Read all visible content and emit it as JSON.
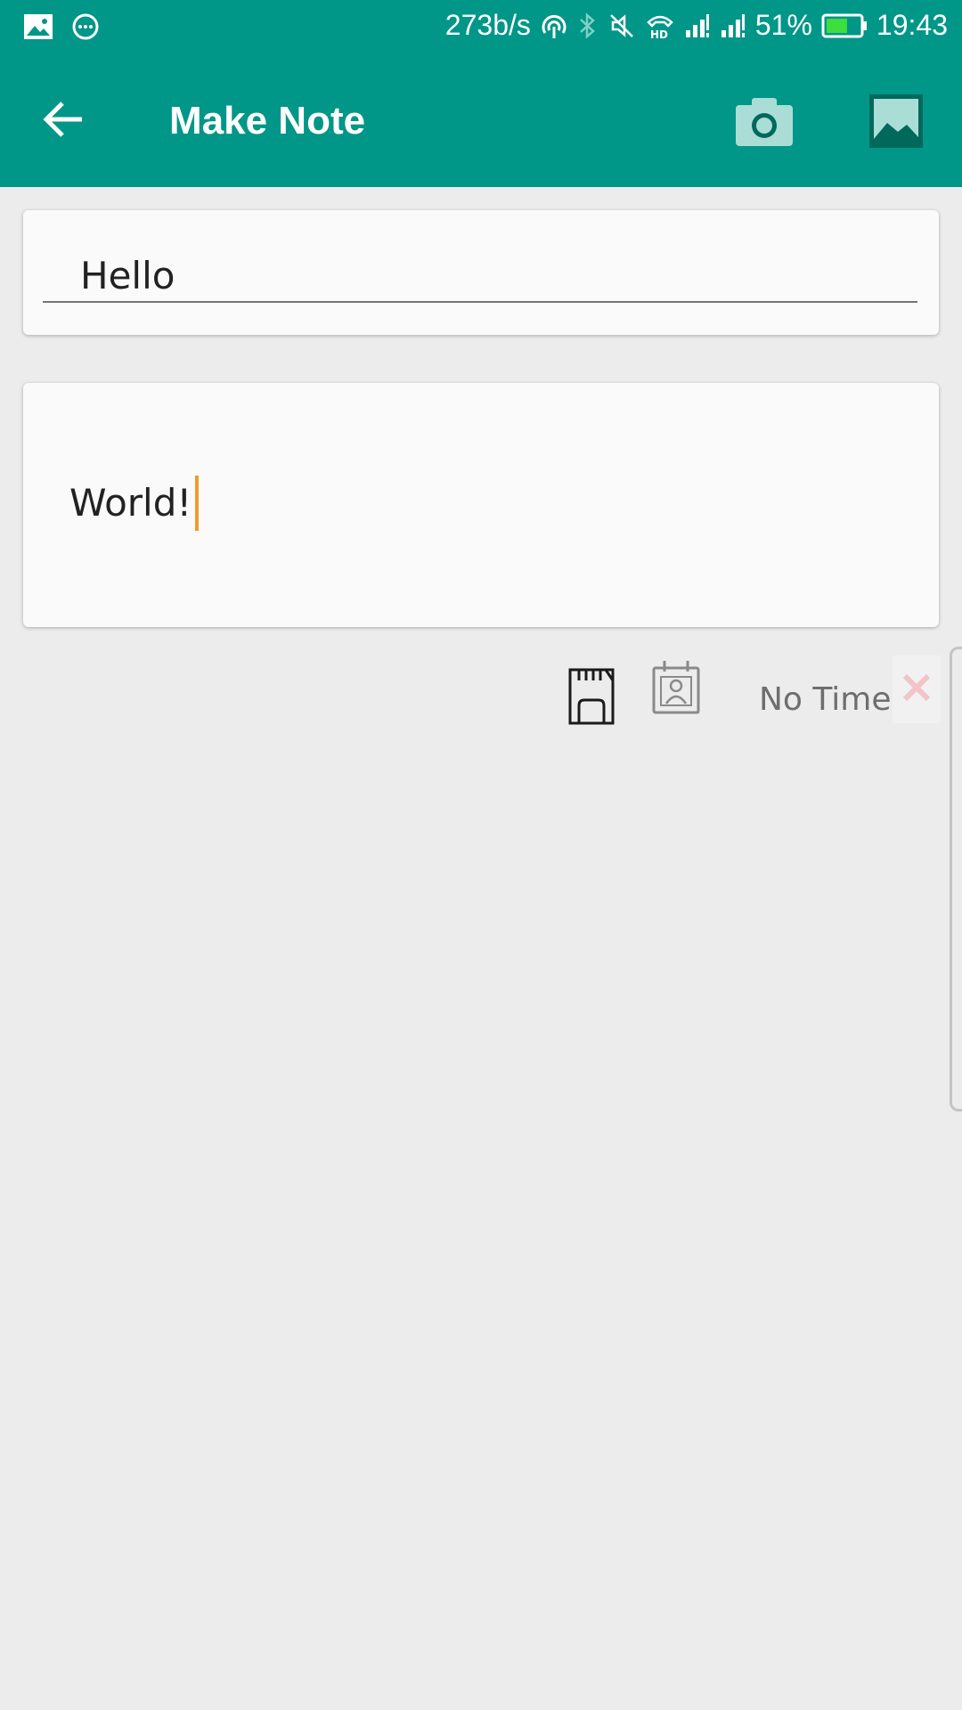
{
  "status_bar": {
    "net_speed": "273b/s",
    "battery": "51%",
    "time": "19:43",
    "icons": [
      "image-icon",
      "chat-bubble-icon",
      "hotspot-icon",
      "bluetooth-icon",
      "mute-icon",
      "hd-call-icon",
      "signal-icon",
      "signal-icon",
      "battery-icon"
    ]
  },
  "app_bar": {
    "title": "Make Note",
    "back_icon": "arrow-left-icon",
    "camera_icon": "camera-icon",
    "gallery_icon": "image-icon",
    "color": "#009688"
  },
  "note": {
    "title_value": "Hello",
    "body_value": "World!",
    "cursor_color": "#f09a2e"
  },
  "actions": {
    "save_icon": "sd-card-icon",
    "contact_icon": "contact-calendar-icon",
    "time_label": "No Time",
    "clear_icon": "close-icon"
  }
}
